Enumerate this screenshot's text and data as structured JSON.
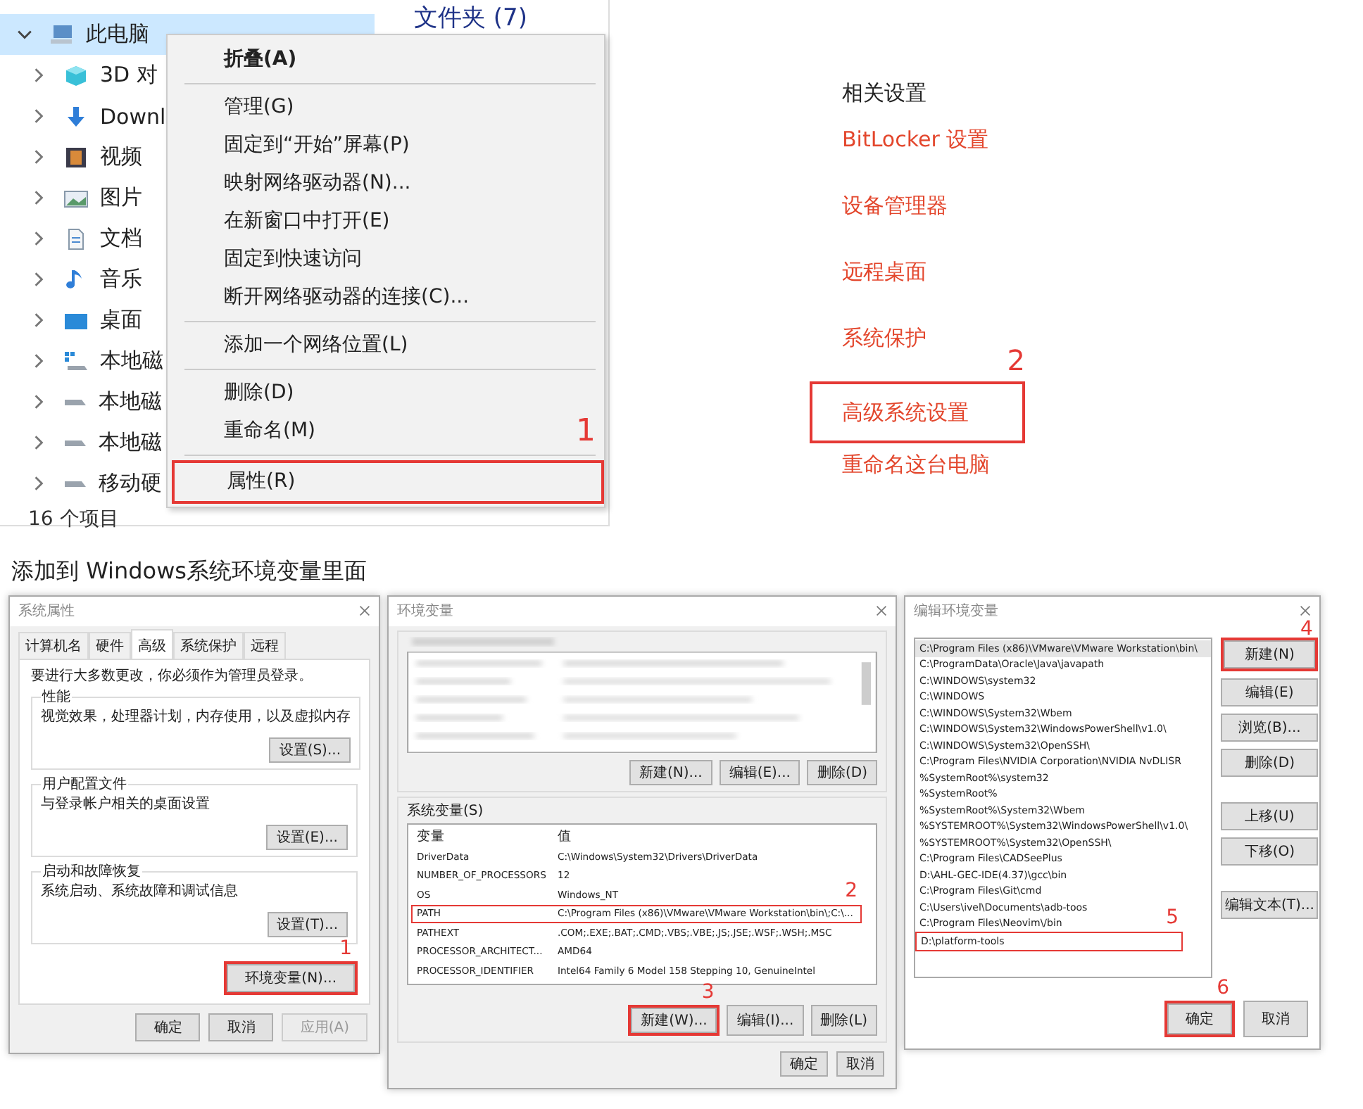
{
  "explorer": {
    "tree": [
      {
        "label": "此电脑",
        "expanded": true,
        "selected": true,
        "children": [
          {
            "label": "3D 对",
            "expanded": false,
            "selected": false
          },
          {
            "label": "Downl",
            "expanded": false,
            "selected": false
          },
          {
            "label": "视频",
            "expanded": false,
            "selected": false
          },
          {
            "label": "图片",
            "expanded": false,
            "selected": false
          },
          {
            "label": "文档",
            "expanded": false,
            "selected": false
          },
          {
            "label": "音乐",
            "expanded": false,
            "selected": false
          },
          {
            "label": "桌面",
            "expanded": false,
            "selected": false
          },
          {
            "label": "本地磁",
            "expanded": false,
            "selected": false
          },
          {
            "label": "本地磁",
            "expanded": false,
            "selected": false
          },
          {
            "label": "本地磁",
            "expanded": false,
            "selected": false
          },
          {
            "label": "移动硬",
            "expanded": false,
            "selected": false
          }
        ]
      }
    ],
    "pane_header": "文件夹 (7)",
    "status": "16 个项目"
  },
  "context_menu": {
    "groups": [
      [
        {
          "label": "折叠(A)",
          "default": true
        }
      ],
      [
        {
          "label": "管理(G)",
          "default": false
        },
        {
          "label": "固定到“开始”屏幕(P)",
          "default": false
        },
        {
          "label": "映射网络驱动器(N)...",
          "default": false
        },
        {
          "label": "在新窗口中打开(E)",
          "default": false
        },
        {
          "label": "固定到快速访问",
          "default": false
        },
        {
          "label": "断开网络驱动器的连接(C)...",
          "default": false
        }
      ],
      [
        {
          "label": "添加一个网络位置(L)",
          "default": false
        }
      ],
      [
        {
          "label": "删除(D)",
          "default": false
        },
        {
          "label": "重命名(M)",
          "default": false
        }
      ],
      [
        {
          "label": "属性(R)",
          "default": false,
          "marker": "1"
        }
      ]
    ]
  },
  "related_settings": {
    "heading": "相关设置",
    "links": [
      {
        "label": "BitLocker 设置"
      },
      {
        "label": "设备管理器"
      },
      {
        "label": "远程桌面"
      },
      {
        "label": "系统保护"
      },
      {
        "label": "高级系统设置",
        "marker": "2"
      },
      {
        "label": "重命名这台电脑"
      }
    ]
  },
  "caption": "添加到 Windows系统环境变量里面",
  "system_properties": {
    "title": "系统属性",
    "tabs": [
      {
        "label": "计算机名",
        "selected": false
      },
      {
        "label": "硬件",
        "selected": false
      },
      {
        "label": "高级",
        "selected": true
      },
      {
        "label": "系统保护",
        "selected": false
      },
      {
        "label": "远程",
        "selected": false
      }
    ],
    "notice": "要进行大多数更改，你必须作为管理员登录。",
    "groups": [
      {
        "label": "性能",
        "description": "视觉效果，处理器计划，内存使用，以及虚拟内存",
        "button": "设置(S)..."
      },
      {
        "label": "用户配置文件",
        "description": "与登录帐户相关的桌面设置",
        "button": "设置(E)..."
      },
      {
        "label": "启动和故障恢复",
        "description": "系统启动、系统故障和调试信息",
        "button": "设置(T)..."
      }
    ],
    "env_button": {
      "label": "环境变量(N)...",
      "marker": "1"
    },
    "buttons": [
      {
        "label": "确定",
        "disabled": false
      },
      {
        "label": "取消",
        "disabled": false
      },
      {
        "label": "应用(A)",
        "disabled": true
      }
    ]
  },
  "environment_variables": {
    "title": "环境变量",
    "user_buttons": [
      "新建(N)...",
      "编辑(E)...",
      "删除(D)"
    ],
    "system_label": "系统变量(S)",
    "columns": [
      "变量",
      "值"
    ],
    "rows": [
      {
        "name": "DriverData",
        "value": "C:\\Windows\\System32\\Drivers\\DriverData"
      },
      {
        "name": "NUMBER_OF_PROCESSORS",
        "value": "12"
      },
      {
        "name": "OS",
        "value": "Windows_NT"
      },
      {
        "name": "PATH",
        "value": "C:\\Program Files (x86)\\VMware\\VMware Workstation\\bin\\;C:\\...",
        "marker": "2"
      },
      {
        "name": "PATHEXT",
        "value": ".COM;.EXE;.BAT;.CMD;.VBS;.VBE;.JS;.JSE;.WSF;.WSH;.MSC"
      },
      {
        "name": "PROCESSOR_ARCHITECT...",
        "value": "AMD64"
      },
      {
        "name": "PROCESSOR_IDENTIFIER",
        "value": "Intel64 Family 6 Model 158 Stepping 10, GenuineIntel"
      }
    ],
    "system_buttons": [
      {
        "label": "新建(W)...",
        "marker": "3"
      },
      {
        "label": "编辑(I)..."
      },
      {
        "label": "删除(L)"
      }
    ],
    "buttons": [
      "确定",
      "取消"
    ]
  },
  "edit_variable": {
    "title": "编辑环境变量",
    "paths": [
      {
        "value": "C:\\Program Files (x86)\\VMware\\VMware Workstation\\bin\\",
        "selected": true
      },
      {
        "value": "C:\\ProgramData\\Oracle\\Java\\javapath",
        "selected": false
      },
      {
        "value": "C:\\WINDOWS\\system32",
        "selected": false
      },
      {
        "value": "C:\\WINDOWS",
        "selected": false
      },
      {
        "value": "C:\\WINDOWS\\System32\\Wbem",
        "selected": false
      },
      {
        "value": "C:\\WINDOWS\\System32\\WindowsPowerShell\\v1.0\\",
        "selected": false
      },
      {
        "value": "C:\\WINDOWS\\System32\\OpenSSH\\",
        "selected": false
      },
      {
        "value": "C:\\Program Files\\NVIDIA Corporation\\NVIDIA NvDLISR",
        "selected": false
      },
      {
        "value": "%SystemRoot%\\system32",
        "selected": false
      },
      {
        "value": "%SystemRoot%",
        "selected": false
      },
      {
        "value": "%SystemRoot%\\System32\\Wbem",
        "selected": false
      },
      {
        "value": "%SYSTEMROOT%\\System32\\WindowsPowerShell\\v1.0\\",
        "selected": false
      },
      {
        "value": "%SYSTEMROOT%\\System32\\OpenSSH\\",
        "selected": false
      },
      {
        "value": "C:\\Program Files\\CADSeePlus",
        "selected": false
      },
      {
        "value": "D:\\AHL-GEC-IDE(4.37)\\gcc\\bin",
        "selected": false
      },
      {
        "value": "C:\\Program Files\\Git\\cmd",
        "selected": false
      },
      {
        "value": "C:\\Users\\ivel\\Documents\\adb-toos",
        "selected": false
      },
      {
        "value": "C:\\Program Files\\Neovim\\/bin",
        "selected": false
      },
      {
        "value": "D:\\platform-tools",
        "selected": false,
        "marker": "5"
      }
    ],
    "button_groups": [
      [
        {
          "label": "新建(N)",
          "marker": "4"
        },
        {
          "label": "编辑(E)"
        },
        {
          "label": "浏览(B)..."
        },
        {
          "label": "删除(D)"
        }
      ],
      [
        {
          "label": "上移(U)"
        },
        {
          "label": "下移(O)"
        }
      ],
      [
        {
          "label": "编辑文本(T)..."
        }
      ]
    ],
    "ok": {
      "label": "确定",
      "marker": "6"
    },
    "cancel": "取消"
  }
}
